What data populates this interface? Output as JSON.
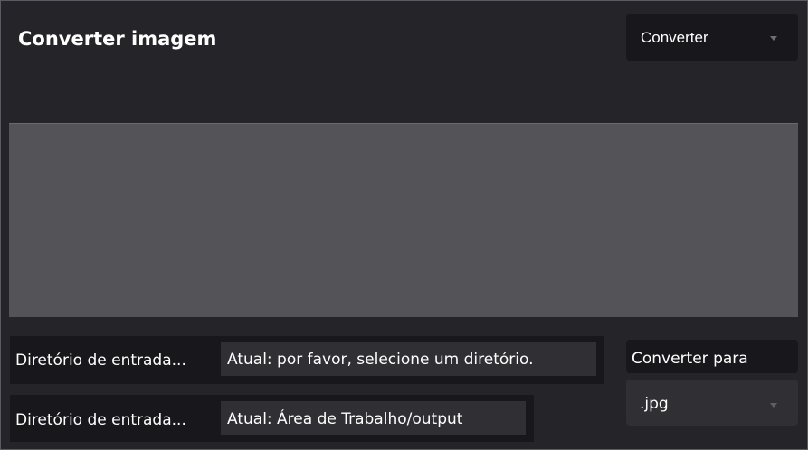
{
  "app": {
    "title": "Converter imagem"
  },
  "mode_select": {
    "value": "Converter",
    "icon": "chevron-down-icon"
  },
  "preview": {
    "color": "#545358"
  },
  "input_directory": {
    "label": "Diretório de entrada...",
    "value": "Atual: por favor, selecione um diretório."
  },
  "output_directory": {
    "label": "Diretório de entrada...",
    "value": "Atual: Área de Trabalho/output"
  },
  "convert_to": {
    "label": "Converter para",
    "value": ".jpg",
    "icon": "chevron-down-icon"
  },
  "colors": {
    "background": "#242429",
    "panel": "#18181c",
    "field": "#2f2f34",
    "preview": "#545358",
    "text": "#ffffff"
  }
}
